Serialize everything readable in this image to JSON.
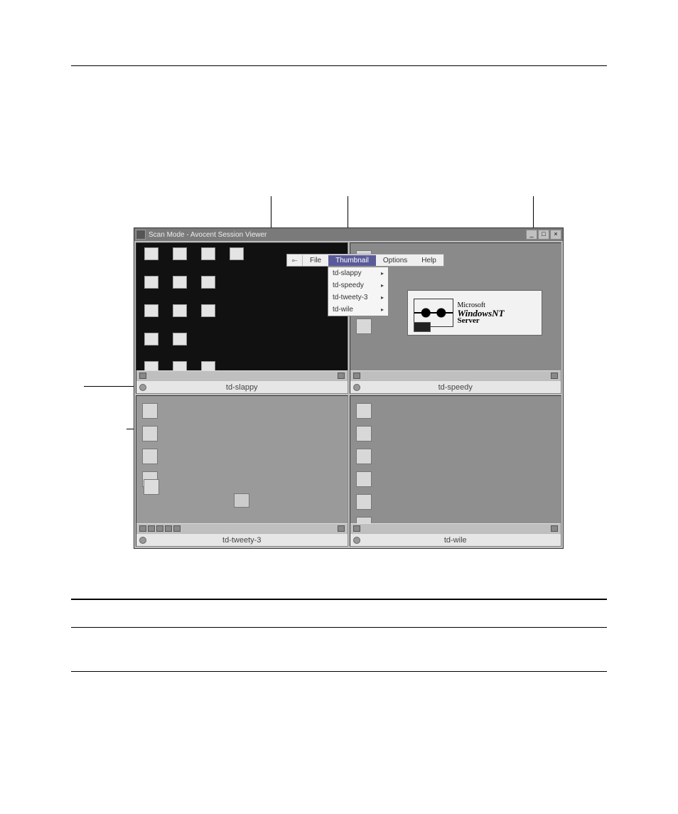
{
  "window": {
    "title": "Scan Mode - Avocent Session Viewer"
  },
  "menubar": {
    "pin_glyph": "⟜",
    "items": {
      "file": "File",
      "thumbnail": "Thumbnail",
      "options": "Options",
      "help": "Help"
    }
  },
  "dropdown": {
    "items": [
      "td-slappy",
      "td-speedy",
      "td-tweety-3",
      "td-wile"
    ]
  },
  "panes": {
    "a": {
      "caption": "td-slappy"
    },
    "b": {
      "caption": "td-speedy"
    },
    "c": {
      "caption": "td-tweety-3"
    },
    "d": {
      "caption": "td-wile"
    }
  },
  "nt_popup": {
    "line1": "Microsoft",
    "line2": "WindowsNT",
    "line3": "Server"
  },
  "win_controls": {
    "minimize": "_",
    "maximize": "□",
    "close": "×"
  },
  "submenu_arrow": "▸"
}
